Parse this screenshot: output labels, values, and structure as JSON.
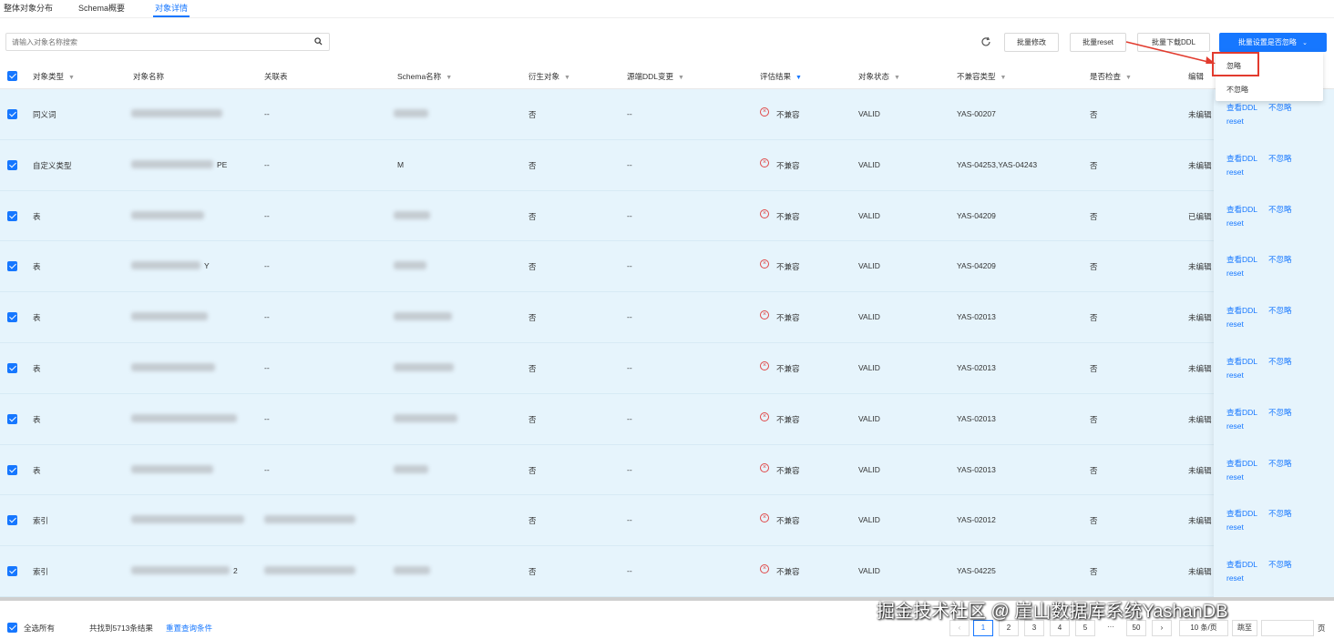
{
  "tabs": [
    {
      "label": "整体对象分布"
    },
    {
      "label": "Schema概要"
    },
    {
      "label": "对象详情"
    }
  ],
  "toolbar": {
    "search_placeholder": "请输入对象名称搜索",
    "buttons": [
      "批量修改",
      "批量reset",
      "批量下载DDL",
      "批量设置是否忽略"
    ]
  },
  "dropdown": {
    "items": [
      "忽略",
      "不忽略"
    ]
  },
  "table": {
    "headers": [
      "对象类型",
      "对象名称",
      "关联表",
      "Schema名称",
      "衍生对象",
      "源端DDL变更",
      "评估结果",
      "对象状态",
      "不兼容类型",
      "是否检查",
      "编辑"
    ],
    "rows": [
      {
        "type": "同义词",
        "derived": "否",
        "ddl": "--",
        "related": "--",
        "result": "不兼容",
        "status": "VALID",
        "incompat": "YAS-00207",
        "check": "否",
        "edit": "未编辑",
        "name_suffix": "",
        "schema": ""
      },
      {
        "type": "自定义类型",
        "derived": "否",
        "ddl": "--",
        "related": "--",
        "result": "不兼容",
        "status": "VALID",
        "incompat": "YAS-04253,YAS-04243",
        "check": "否",
        "edit": "未编辑",
        "name_suffix": "PE",
        "schema": "M"
      },
      {
        "type": "表",
        "derived": "否",
        "ddl": "--",
        "related": "--",
        "result": "不兼容",
        "status": "VALID",
        "incompat": "YAS-04209",
        "check": "否",
        "edit": "已编辑",
        "name_suffix": "",
        "schema": ""
      },
      {
        "type": "表",
        "derived": "否",
        "ddl": "--",
        "related": "--",
        "result": "不兼容",
        "status": "VALID",
        "incompat": "YAS-04209",
        "check": "否",
        "edit": "未编辑",
        "name_suffix": "Y",
        "schema": ""
      },
      {
        "type": "表",
        "derived": "否",
        "ddl": "--",
        "related": "--",
        "result": "不兼容",
        "status": "VALID",
        "incompat": "YAS-02013",
        "check": "否",
        "edit": "未编辑",
        "name_suffix": "",
        "schema": ""
      },
      {
        "type": "表",
        "derived": "否",
        "ddl": "--",
        "related": "--",
        "result": "不兼容",
        "status": "VALID",
        "incompat": "YAS-02013",
        "check": "否",
        "edit": "未编辑",
        "name_suffix": "",
        "schema": ""
      },
      {
        "type": "表",
        "derived": "否",
        "ddl": "--",
        "related": "--",
        "result": "不兼容",
        "status": "VALID",
        "incompat": "YAS-02013",
        "check": "否",
        "edit": "未编辑",
        "name_suffix": "",
        "schema": ""
      },
      {
        "type": "表",
        "derived": "否",
        "ddl": "--",
        "related": "--",
        "result": "不兼容",
        "status": "VALID",
        "incompat": "YAS-02013",
        "check": "否",
        "edit": "未编辑",
        "name_suffix": "",
        "schema": ""
      },
      {
        "type": "索引",
        "derived": "否",
        "ddl": "--",
        "related": "",
        "result": "不兼容",
        "status": "VALID",
        "incompat": "YAS-02012",
        "check": "否",
        "edit": "未编辑",
        "name_suffix": "",
        "schema": ""
      },
      {
        "type": "索引",
        "derived": "否",
        "ddl": "--",
        "related": "",
        "result": "不兼容",
        "status": "VALID",
        "incompat": "YAS-04225",
        "check": "否",
        "edit": "未编辑",
        "name_suffix": "2",
        "schema": ""
      }
    ],
    "actions": {
      "view": "查看DDL",
      "ignore": "不忽略",
      "reset": "reset"
    }
  },
  "footer": {
    "select_all": "全选所有",
    "total": "共找到5713条结果",
    "reset_query": "重置查询条件",
    "pages": [
      "1",
      "2",
      "3",
      "4",
      "5",
      "···",
      "50"
    ],
    "page_size": "10 条/页",
    "jump": "跳至",
    "page_unit": "页"
  },
  "watermark": "掘金技术社区 @ 崖山数据库系统YashanDB",
  "colors": {
    "primary": "#1677ff",
    "row_bg": "#e6f4fc",
    "error": "#e04848",
    "highlight": "#e23b2e"
  }
}
